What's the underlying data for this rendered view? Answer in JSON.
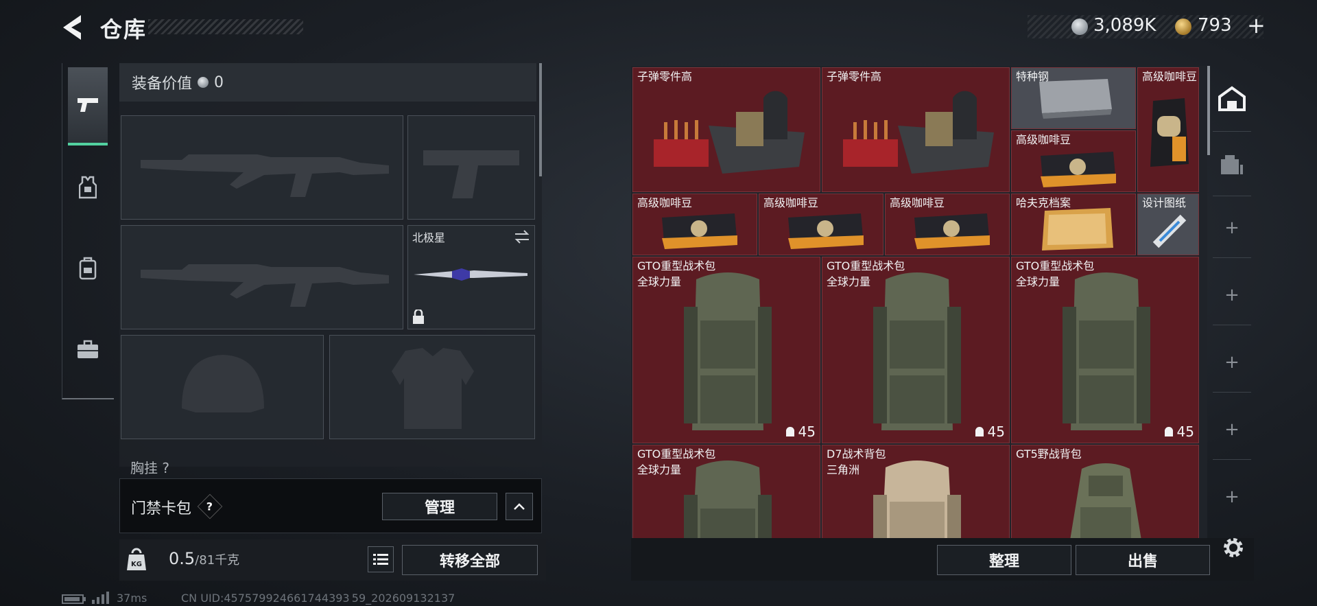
{
  "header": {
    "title": "仓库",
    "silver": "3,089K",
    "gold": "793",
    "gold_plus": "+"
  },
  "tabs": [
    {
      "name": "weapons",
      "icon": "pistol-icon"
    },
    {
      "name": "armor",
      "icon": "vest-icon"
    },
    {
      "name": "backpack",
      "icon": "backpack-icon"
    },
    {
      "name": "tools",
      "icon": "toolbox-icon"
    }
  ],
  "equipment": {
    "value_label": "装备价值",
    "value": "0",
    "melee_label": "北极星",
    "chest_label": "胸挂 ?"
  },
  "keycard": {
    "title": "门禁卡包",
    "help": "?",
    "manage_label": "管理"
  },
  "weight": {
    "current": "0.5",
    "max": "/81",
    "unit": "千克",
    "kg_label": "KG",
    "transfer_all_label": "转移全部"
  },
  "status": {
    "ping": "37ms",
    "uid": "CN UID:457579924661744393 59_202609132137"
  },
  "grid": {
    "items": [
      {
        "name": "子弹零件高",
        "sub": "",
        "count": ""
      },
      {
        "name": "子弹零件高",
        "sub": "",
        "count": ""
      },
      {
        "name": "特种钢",
        "sub": "",
        "count": ""
      },
      {
        "name": "高级咖啡豆",
        "sub": "",
        "count": ""
      },
      {
        "name": "高级咖啡豆",
        "sub": "",
        "count": ""
      },
      {
        "name": "高级咖啡豆",
        "sub": "",
        "count": ""
      },
      {
        "name": "高级咖啡豆",
        "sub": "",
        "count": ""
      },
      {
        "name": "高级咖啡豆",
        "sub": "",
        "count": ""
      },
      {
        "name": "哈夫克档案",
        "sub": "",
        "count": ""
      },
      {
        "name": "设计图纸",
        "sub": "",
        "count": ""
      },
      {
        "name": "GTO重型战术包",
        "sub": "全球力量",
        "count": "45"
      },
      {
        "name": "GTO重型战术包",
        "sub": "全球力量",
        "count": "45"
      },
      {
        "name": "GTO重型战术包",
        "sub": "全球力量",
        "count": "45"
      },
      {
        "name": "GTO重型战术包",
        "sub": "全球力量",
        "count": ""
      },
      {
        "name": "D7战术背包",
        "sub": "三角洲",
        "count": ""
      },
      {
        "name": "GT5野战背包",
        "sub": "",
        "count": ""
      }
    ],
    "sort_label": "整理",
    "sell_label": "出售"
  },
  "side_slots": [
    "+",
    "+",
    "+",
    "+",
    "+"
  ],
  "colors": {
    "accent": "#52d1a0",
    "cell_bg": "#5c1b22",
    "cell_border": "#7a343b"
  }
}
